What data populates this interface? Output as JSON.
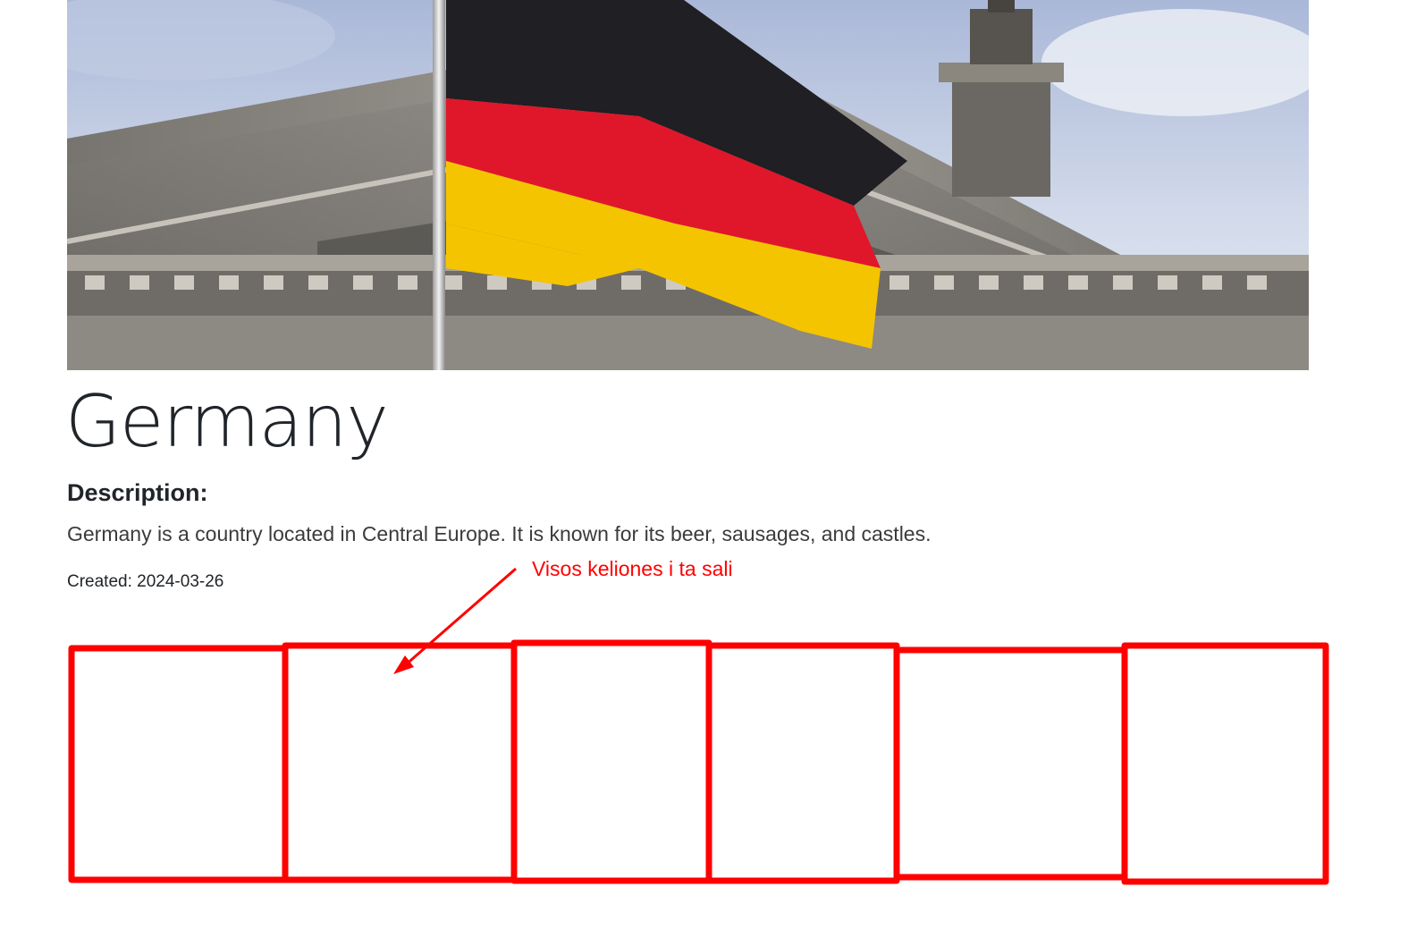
{
  "country": {
    "name": "Germany",
    "description_heading": "Description:",
    "description": "Germany is a country located in Central Europe. It is known for its beer, sausages, and castles.",
    "created": "Created: 2024-03-26"
  },
  "hero_image": {
    "alt": "German flag in front of the Reichstag building"
  },
  "annotation": {
    "text": "Visos keliones i ta sali",
    "color": "#ff0000",
    "placeholder_box_count": 6
  },
  "colors": {
    "flag_black": "#1f1f24",
    "flag_red": "#e0172a",
    "flag_gold": "#f5c400",
    "annotation_red": "#ff0000"
  }
}
